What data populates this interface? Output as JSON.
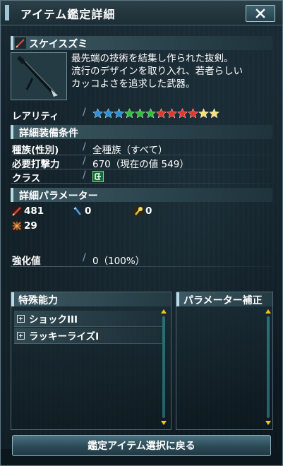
{
  "window": {
    "title": "アイテム鑑定詳細"
  },
  "item": {
    "name": "スケイスズミ",
    "description": [
      "最先端の技術を結集し作られた抜剣。",
      "流行のデザインを取り入れ、若者らしい",
      "カッコよさを追求した武器。"
    ],
    "icon": "sword-icon"
  },
  "rarity": {
    "label": "レアリティ",
    "stars": 12,
    "star_colors": [
      "#2a8fd6",
      "#2a8fd6",
      "#2a8fd6",
      "#2fbf3c",
      "#2fbf3c",
      "#2fbf3c",
      "#e6342a",
      "#e6342a",
      "#e6342a",
      "#e6342a",
      "#f6e27a",
      "#f6e27a"
    ]
  },
  "equip": {
    "header": "詳細装備条件",
    "rows": [
      {
        "label": "種族(性別)",
        "value": "全種族（すべて）"
      },
      {
        "label": "必要打撃力",
        "value": "670（現在の値 549）"
      },
      {
        "label": "クラス",
        "value": "",
        "icon": "braver-class-icon"
      }
    ]
  },
  "params": {
    "header": "詳細パラメーター",
    "items": [
      {
        "icon": "melee-attack-icon",
        "value": "481",
        "color": "#e04a3a"
      },
      {
        "icon": "ranged-attack-icon",
        "value": "0",
        "color": "#4aa0e0"
      },
      {
        "icon": "tech-attack-icon",
        "value": "0",
        "color": "#e0c040"
      },
      {
        "icon": "dexterity-icon",
        "value": "29",
        "color": "#e07a3a"
      }
    ]
  },
  "enhance": {
    "label": "強化値",
    "value": "0（100%）"
  },
  "abilities": {
    "header": "特殊能力",
    "items": [
      "ショックIII",
      "ラッキーライズI"
    ]
  },
  "param_bonus": {
    "header": "パラメーター補正"
  },
  "back_button": {
    "label": "鑑定アイテム選択に戻る"
  }
}
